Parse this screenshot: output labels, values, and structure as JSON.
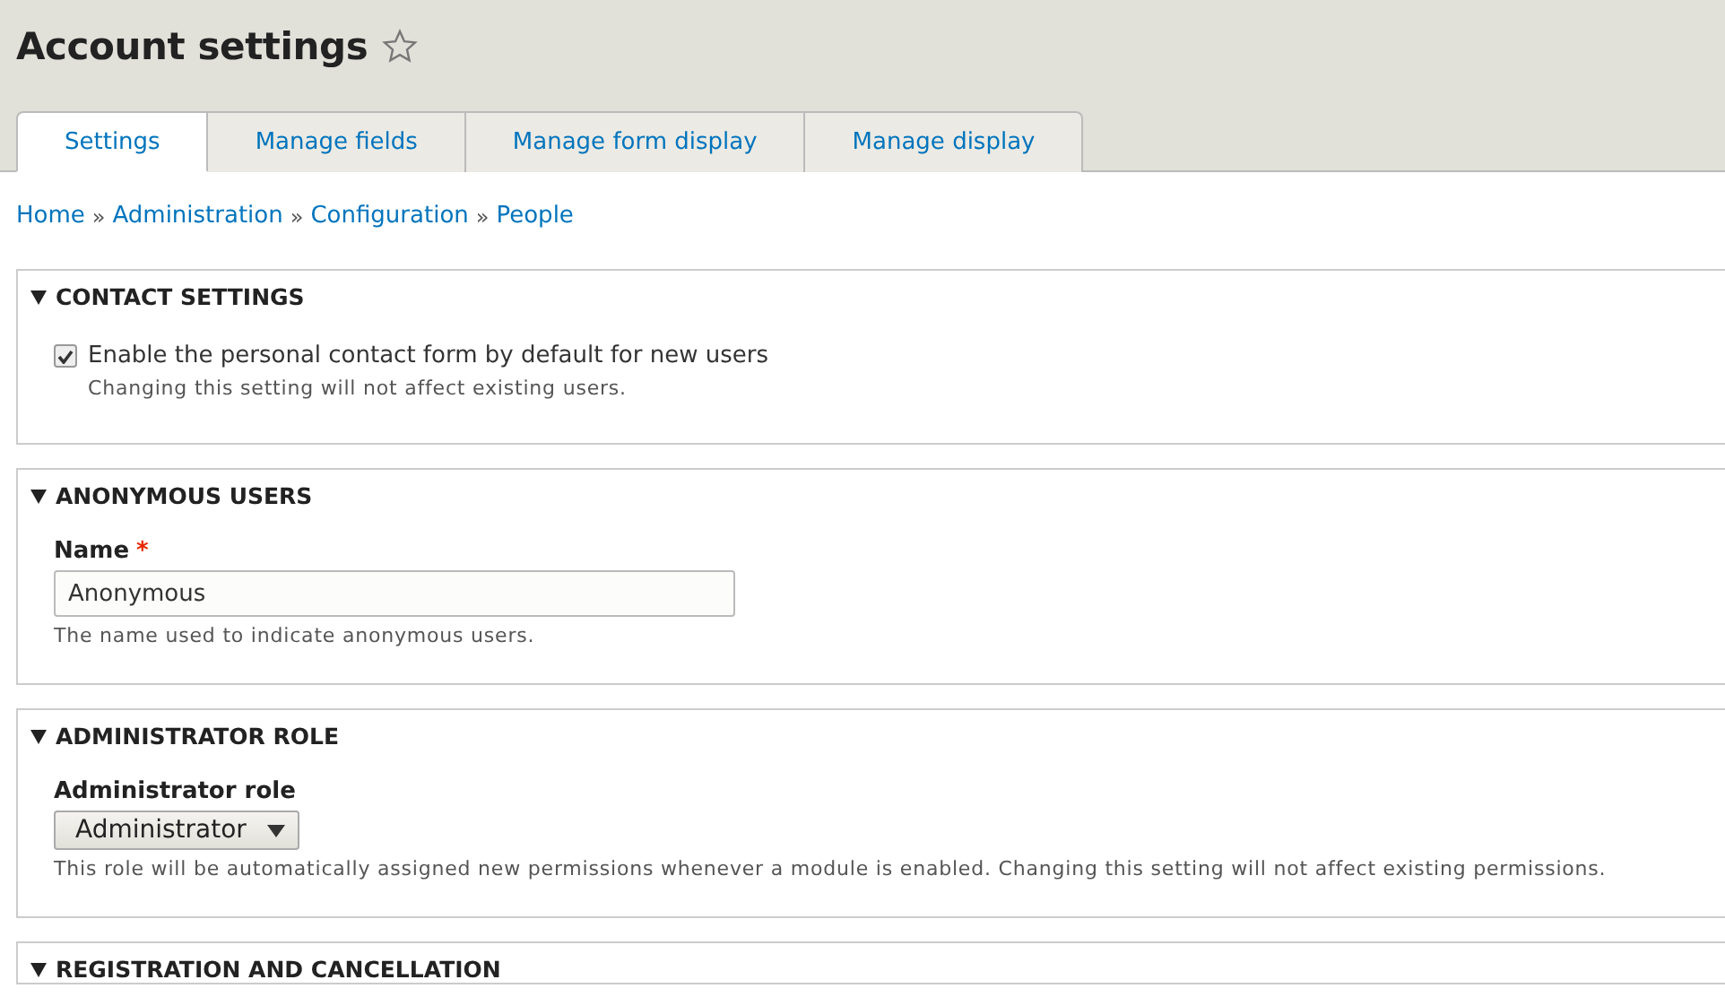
{
  "page": {
    "title": "Account settings",
    "starred": false
  },
  "tabs": [
    {
      "label": "Settings",
      "selected": true
    },
    {
      "label": "Manage fields",
      "selected": false
    },
    {
      "label": "Manage form display",
      "selected": false
    },
    {
      "label": "Manage display",
      "selected": false
    }
  ],
  "breadcrumb": [
    "Home",
    "Administration",
    "Configuration",
    "People"
  ],
  "breadcrumb_separator": "»",
  "sections": [
    {
      "title": "CONTACT SETTINGS",
      "expanded": true,
      "kind": "checkbox",
      "label": "Enable the personal contact form by default for new users",
      "checked": true,
      "description": "Changing this setting will not affect existing users."
    },
    {
      "title": "ANONYMOUS USERS",
      "expanded": true,
      "kind": "textfield",
      "label": "Name",
      "required_mark": "*",
      "value": "Anonymous",
      "description": "The name used to indicate anonymous users."
    },
    {
      "title": "ADMINISTRATOR ROLE",
      "expanded": true,
      "kind": "select",
      "label": "Administrator role",
      "value": "Administrator",
      "description": "This role will be automatically assigned new permissions whenever a module is enabled. Changing this setting will not affect existing permissions."
    },
    {
      "title": "REGISTRATION AND CANCELLATION",
      "expanded": true,
      "kind": "collapsed"
    }
  ]
}
